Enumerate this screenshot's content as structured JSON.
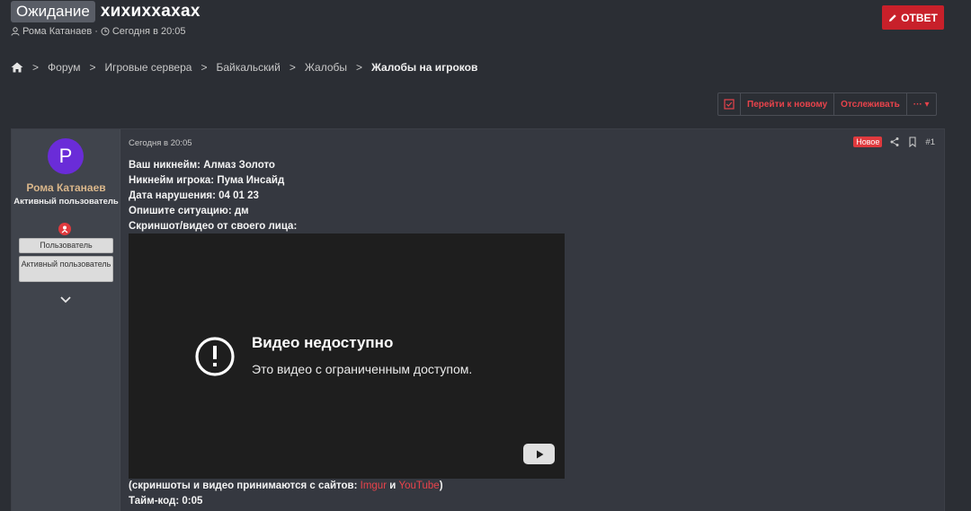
{
  "header": {
    "prefix": "Ожидание",
    "title": "хихиххахах",
    "author": "Рома Катанаев",
    "separator": "·",
    "date": "Сегодня в 20:05"
  },
  "reply_button": {
    "label": "ОТВЕТ"
  },
  "breadcrumbs": {
    "items": [
      "Форум",
      "Игровые сервера",
      "Байкальский",
      "Жалобы"
    ],
    "current": "Жалобы на игроков",
    "separator": ">"
  },
  "actions": {
    "go_new": "Перейти к новому",
    "watch": "Отслеживать",
    "more": "··· ▾"
  },
  "post": {
    "avatar_letter": "P",
    "username": "Рома Катанаев",
    "user_title": "Активный пользователь",
    "banners": [
      "Пользователь",
      "Активный пользователь"
    ],
    "date": "Сегодня в 20:05",
    "new_badge": "Новое",
    "number": "#1",
    "lines": [
      "Ваш никнейм: Алмаз Золото",
      "Никнейм игрока: Пума Инсайд",
      "Дата нарушения: 04 01 23",
      "Опишите ситуацию: дм",
      "Скриншот/видео от своего лица:"
    ],
    "footnote_prefix": "(скриншоты и видео принимаются с сайтов: ",
    "link_imgur": "Imgur",
    "footnote_and": " и ",
    "link_youtube": "YouTube",
    "footnote_suffix": ")",
    "timecode": "Тайм-код: 0:05"
  },
  "video": {
    "title": "Видео недоступно",
    "subtitle": "Это видео с ограниченным доступом."
  },
  "colors": {
    "accent": "#c8202a",
    "link": "#e8434b",
    "background": "#2b2e34",
    "avatar": "#6a2cd8"
  }
}
